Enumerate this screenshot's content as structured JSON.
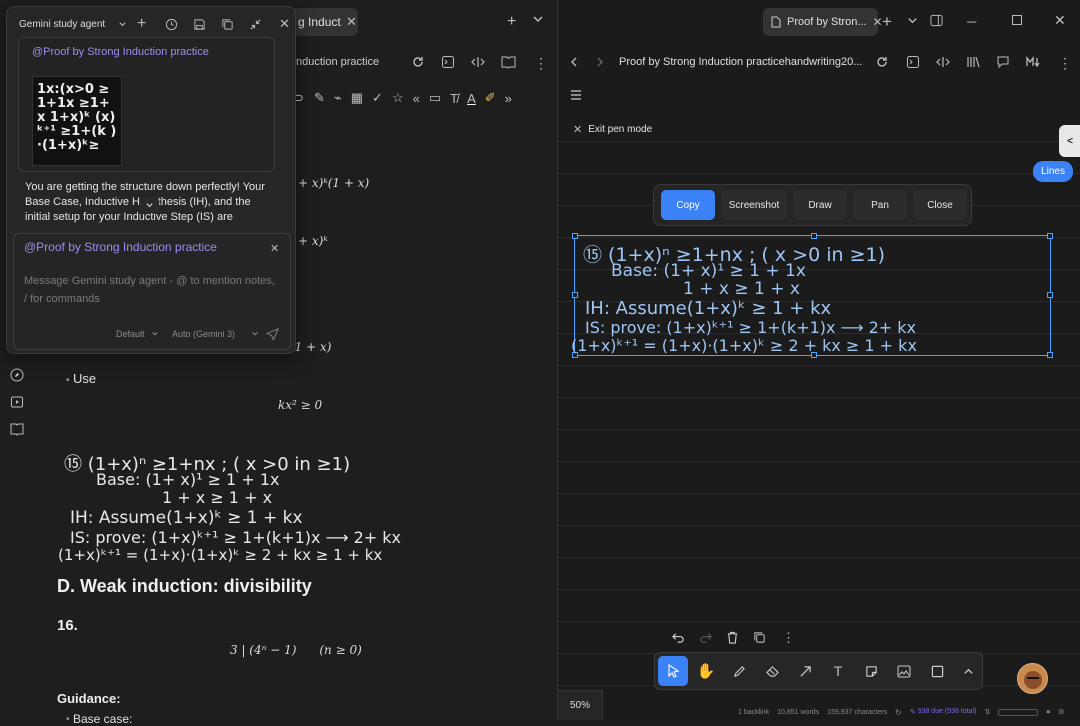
{
  "left": {
    "tab_title": "g Induct...",
    "header_title": "nduction practice",
    "use_label": "Use",
    "math_use": "kx² ≥ 0",
    "math_frag1": "+ x)ᵏ(1 + x)",
    "math_frag2": "+ x)ᵏ",
    "math_frag3": "(1 + x)",
    "handwriting": {
      "line1": "⑮ (1+x)ⁿ ≥1+nx ; ( x >0 in ≥1)",
      "line2": "Base: (1+ x)¹ ≥ 1 + 1x",
      "line3": "1 + x ≥ 1 + x",
      "line4": "IH: Assume(1+x)ᵏ ≥ 1 + kx",
      "line5": "IS: prove: (1+x)ᵏ⁺¹ ≥ 1+(k+1)x ⟶ 2+ kx",
      "line6": "(1+x)ᵏ⁺¹ = (1+x)·(1+x)ᵏ ≥ 2 + kx ≥ 1 + kx"
    },
    "section_heading": "D. Weak induction: divisibility",
    "problem_number": "16.",
    "problem_math": "3 | (4ⁿ − 1)      (n ≥ 0)",
    "guidance_label": "Guidance:",
    "base_case": "Base case:"
  },
  "gemini": {
    "title": "Gemini study agent",
    "mention": "@Proof by Strong Induction practice",
    "thumb_text": "1x:(x>0 ≥1+1x ≥1+x 1+x)ᵏ (x)ᵏ⁺¹ ≥1+(k )·(1+x)ᵏ≥",
    "response": "You are getting the structure down perfectly! Your Base Case, Inductive Hypothesis (IH), and the initial setup for your Inductive Step (IS) are",
    "input_mention": "@Proof by Strong Induction practice",
    "placeholder": "Message Gemini study agent - @ to mention notes, / for commands",
    "mode": "Default",
    "model": "Auto (Gemini 3)"
  },
  "right": {
    "tab_title": "Proof by Stron...",
    "header_title": "Proof by Strong Induction practicehandwriting20...",
    "exit_pen": "Exit pen mode",
    "lines_badge": "Lines",
    "collapse_glyph": "<",
    "actions": [
      "Copy",
      "Screenshot",
      "Draw",
      "Pan",
      "Close"
    ],
    "zoom": "50%",
    "status": {
      "backlinks": "1 backlink",
      "words": "10,851 words",
      "chars": "159,937 characters",
      "due": "938 due (938 total)"
    }
  },
  "colors": {
    "accent": "#3b82f6",
    "mention": "#9d8cf2",
    "selection": "#4aa3ff"
  }
}
